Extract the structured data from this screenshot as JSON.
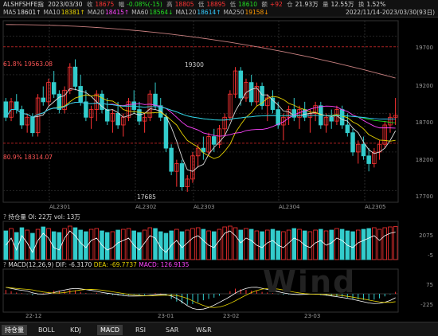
{
  "header": {
    "symbol": "ALSHFSHFE指",
    "date": "2023/03/30",
    "close_label": "收",
    "close": "18675",
    "change_label": "幅",
    "change": "-0.08%(-15)",
    "high_label": "高",
    "high": "18805",
    "low_label": "低",
    "low": "18895",
    "open_label": "低",
    "open": "18610",
    "ratio_label": "额",
    "ratio": "+92",
    "amount_label": "仓",
    "amount": "21.93万",
    "volume_label": "量",
    "volume": "12.55万",
    "turnover_label": "换",
    "turnover": "1.52%",
    "range": "2022/11/14-2023/03/30(93日)",
    "ma": [
      {
        "label": "MA5",
        "value": "18601↑",
        "color": "#dddddd"
      },
      {
        "label": "MA10",
        "value": "18381↑",
        "color": "#e6d200"
      },
      {
        "label": "MA20",
        "value": "18415↑",
        "color": "#ff44ff"
      },
      {
        "label": "MA60",
        "value": "18564↓",
        "color": "#22dd22"
      },
      {
        "label": "MA120",
        "value": "18614↑",
        "color": "#33ccff"
      },
      {
        "label": "MA250",
        "value": "19158↓",
        "color": "#ff9900"
      }
    ]
  },
  "price_axis": [
    "19700",
    "19200",
    "18700",
    "18200",
    "17700"
  ],
  "fib": {
    "upper": "61.8%  19563.08",
    "lower": "80.9%  18314.07"
  },
  "annotations": {
    "high": "19300",
    "low": "17685"
  },
  "x_axis_contracts": [
    "AL2301",
    "AL2302",
    "AL2303",
    "AL2304",
    "AL2305"
  ],
  "oi_panel": {
    "label": "持仓量",
    "oi": "OI: 22万",
    "vol": "vol: 13万",
    "axis": [
      "2075",
      "-5"
    ]
  },
  "macd_panel": {
    "label": "MACD(12,26,9)",
    "dif": "DIF: -6.3170",
    "dea": "DEA: -69.7737",
    "macd": "MACD: 126.9135",
    "axis": [
      "75",
      "-225"
    ]
  },
  "macd_x_axis": [
    "22-12",
    "23-01",
    "23-02",
    "23-03"
  ],
  "watermark": "Wind",
  "tabs": [
    "持仓量",
    "BOLL",
    "KDJ",
    "MACD",
    "RSI",
    "SAR",
    "W&R"
  ],
  "active_tab": "MACD",
  "colors": {
    "up": "#ff3333",
    "down": "#33cccc",
    "bg": "#000000"
  },
  "chart_data": {
    "type": "candlestick",
    "ylim": [
      17550,
      19900
    ],
    "candles": [
      [
        18850,
        18900,
        18600,
        18650
      ],
      [
        18650,
        18900,
        18600,
        18850
      ],
      [
        18850,
        18950,
        18700,
        18750
      ],
      [
        18750,
        18800,
        18500,
        18550
      ],
      [
        18550,
        18700,
        18450,
        18650
      ],
      [
        18650,
        18700,
        18400,
        18450
      ],
      [
        18450,
        18950,
        18400,
        18900
      ],
      [
        18900,
        19050,
        18800,
        18850
      ],
      [
        18850,
        19150,
        18800,
        19100
      ],
      [
        19100,
        19250,
        18900,
        18950
      ],
      [
        18950,
        19000,
        18700,
        18750
      ],
      [
        18750,
        19050,
        18700,
        19000
      ],
      [
        19000,
        19350,
        18950,
        19300
      ],
      [
        19300,
        19400,
        19000,
        19050
      ],
      [
        19050,
        19200,
        18800,
        18850
      ],
      [
        18850,
        19000,
        18600,
        18650
      ],
      [
        18650,
        18800,
        18500,
        18750
      ],
      [
        18750,
        19000,
        18600,
        18950
      ],
      [
        18950,
        19000,
        18700,
        18750
      ],
      [
        18750,
        18900,
        18550,
        18600
      ],
      [
        18600,
        18750,
        18450,
        18700
      ],
      [
        18700,
        18850,
        18500,
        18550
      ],
      [
        18550,
        18700,
        18400,
        18650
      ],
      [
        18650,
        18900,
        18600,
        18850
      ],
      [
        18850,
        19000,
        18700,
        18750
      ],
      [
        18750,
        18850,
        18550,
        18600
      ],
      [
        18600,
        18700,
        18450,
        18650
      ],
      [
        18650,
        19000,
        18600,
        18950
      ],
      [
        18950,
        19100,
        18750,
        18800
      ],
      [
        18800,
        18900,
        18600,
        18650
      ],
      [
        18650,
        18700,
        18200,
        18250
      ],
      [
        18250,
        18300,
        17900,
        17950
      ],
      [
        17950,
        18100,
        17750,
        18050
      ],
      [
        18050,
        18100,
        17700,
        17750
      ],
      [
        17750,
        17900,
        17685,
        17850
      ],
      [
        17850,
        18200,
        17800,
        18150
      ],
      [
        18150,
        18300,
        18000,
        18250
      ],
      [
        18250,
        18400,
        18100,
        18200
      ],
      [
        18200,
        18450,
        18150,
        18400
      ],
      [
        18400,
        18500,
        18200,
        18300
      ],
      [
        18300,
        18550,
        18250,
        18500
      ],
      [
        18500,
        18700,
        18400,
        18650
      ],
      [
        18650,
        19000,
        18600,
        18950
      ],
      [
        18950,
        19300,
        18900,
        19250
      ],
      [
        19250,
        19300,
        18800,
        18900
      ],
      [
        18900,
        19150,
        18850,
        19100
      ],
      [
        19100,
        19200,
        18800,
        18850
      ],
      [
        18850,
        19100,
        18800,
        19050
      ],
      [
        19050,
        19100,
        18750,
        18800
      ],
      [
        18800,
        18950,
        18600,
        18900
      ],
      [
        18900,
        19000,
        18700,
        18750
      ],
      [
        18750,
        18850,
        18500,
        18550
      ],
      [
        18550,
        18700,
        18350,
        18650
      ],
      [
        18650,
        18800,
        18550,
        18750
      ],
      [
        18750,
        18900,
        18600,
        18650
      ],
      [
        18650,
        18800,
        18500,
        18750
      ],
      [
        18750,
        18850,
        18600,
        18650
      ],
      [
        18650,
        18750,
        18450,
        18700
      ],
      [
        18700,
        18850,
        18600,
        18800
      ],
      [
        18800,
        18850,
        18500,
        18550
      ],
      [
        18550,
        18700,
        18450,
        18650
      ],
      [
        18650,
        18750,
        18500,
        18600
      ],
      [
        18600,
        18800,
        18550,
        18750
      ],
      [
        18750,
        18800,
        18500,
        18550
      ],
      [
        18550,
        18700,
        18400,
        18450
      ],
      [
        18450,
        18500,
        18150,
        18200
      ],
      [
        18200,
        18350,
        18050,
        18300
      ],
      [
        18300,
        18400,
        18100,
        18150
      ],
      [
        18150,
        18250,
        17950,
        18050
      ],
      [
        18050,
        18250,
        18000,
        18200
      ],
      [
        18200,
        18350,
        18100,
        18300
      ],
      [
        18300,
        18600,
        18250,
        18550
      ],
      [
        18550,
        18700,
        18450,
        18650
      ],
      [
        18650,
        18900,
        18550,
        18675
      ]
    ],
    "oi": [
      1800,
      1950,
      1700,
      2000,
      1850,
      1650,
      1900,
      2050,
      1950,
      1750,
      1700,
      1950,
      2100,
      2000,
      1850,
      1750,
      1900,
      1950,
      1800,
      1700,
      1750,
      1850,
      1900,
      1950,
      1800,
      1700,
      1850,
      2000,
      1950,
      1750,
      1650,
      1800,
      1900,
      1750,
      1850,
      1950,
      2000,
      1900,
      1800,
      1750,
      1900,
      2050,
      2100,
      2000,
      1850,
      1950,
      1900,
      1800,
      1750,
      1850,
      1900,
      1800,
      1750,
      1850,
      1950,
      1900,
      1800,
      1750,
      1850,
      1900,
      1800,
      1850,
      1950,
      1900,
      1800,
      1750,
      1850,
      1900,
      1950,
      2000,
      1900,
      2000,
      2050,
      2075
    ],
    "macd": [
      60,
      40,
      20,
      10,
      -5,
      -20,
      -10,
      10,
      30,
      50,
      45,
      40,
      60,
      55,
      30,
      10,
      5,
      15,
      5,
      -10,
      -20,
      -25,
      -30,
      -20,
      -10,
      -15,
      -20,
      -5,
      10,
      5,
      -30,
      -80,
      -120,
      -150,
      -170,
      -160,
      -130,
      -100,
      -80,
      -60,
      -30,
      0,
      40,
      80,
      70,
      60,
      50,
      45,
      30,
      20,
      10,
      -5,
      -15,
      -10,
      -5,
      0,
      5,
      -5,
      -10,
      -20,
      -30,
      -35,
      -40,
      -45,
      -60,
      -80,
      -90,
      -95,
      -100,
      -90,
      -70,
      -40,
      -10,
      30
    ]
  }
}
